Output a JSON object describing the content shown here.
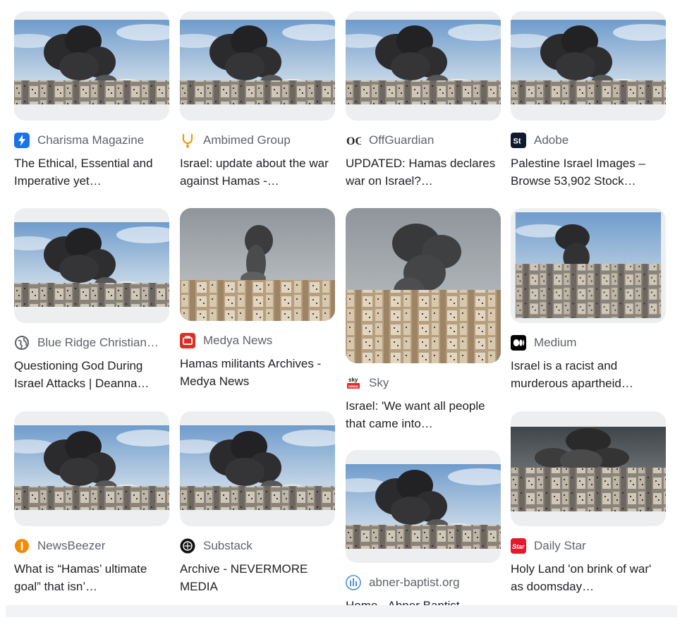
{
  "results": [
    {
      "source": "Charisma Magazine",
      "title": "The Ethical, Essential and Imperative yet…",
      "favicon": "lightning-icon",
      "favicon_color": "#1a73e8"
    },
    {
      "source": "Ambimed Group",
      "title": "Israel: update about the war against Hamas -…",
      "favicon": "stethoscope-icon",
      "favicon_color": "#f29900"
    },
    {
      "source": "OffGuardian",
      "title": "UPDATED: Hamas declares war on Israel?…",
      "favicon": "og-logo-icon",
      "favicon_color": "#202124"
    },
    {
      "source": "Adobe",
      "title": "Palestine Israel Images – Browse 53,902 Stock…",
      "favicon": "adobe-stock-icon",
      "favicon_color": "#0f1c2e"
    },
    {
      "source": "Blue Ridge Christian…",
      "title": "Questioning God During Israel Attacks | Deanna…",
      "favicon": "globe-icon",
      "favicon_color": "#5f6368"
    },
    {
      "source": "Medya News",
      "title": "Hamas militants Archives - Medya News",
      "favicon": "medya-icon",
      "favicon_color": "#d93025"
    },
    {
      "source": "Sky",
      "title": "Israel: 'We want all people that came into…",
      "favicon": "sky-news-icon",
      "favicon_color": "#e52b2b"
    },
    {
      "source": "Medium",
      "title": "Israel is a racist and murderous apartheid…",
      "favicon": "medium-icon",
      "favicon_color": "#000000"
    },
    {
      "source": "NewsBeezer",
      "title": "What is “Hamas’ ultimate goal” that isn’…",
      "favicon": "info-icon",
      "favicon_color": "#f28b00"
    },
    {
      "source": "Substack",
      "title": "Archive - NEVERMORE MEDIA",
      "favicon": "substack-icon",
      "favicon_color": "#111111"
    },
    {
      "source": "abner-baptist.org",
      "title": "Home - Abner Baptist",
      "favicon": "bars-icon",
      "favicon_color": "#4a90d9"
    },
    {
      "source": "Daily Star",
      "title": "Holy Land 'on brink of war' as doomsday…",
      "favicon": "daily-star-icon",
      "favicon_color": "#e8172a"
    }
  ]
}
